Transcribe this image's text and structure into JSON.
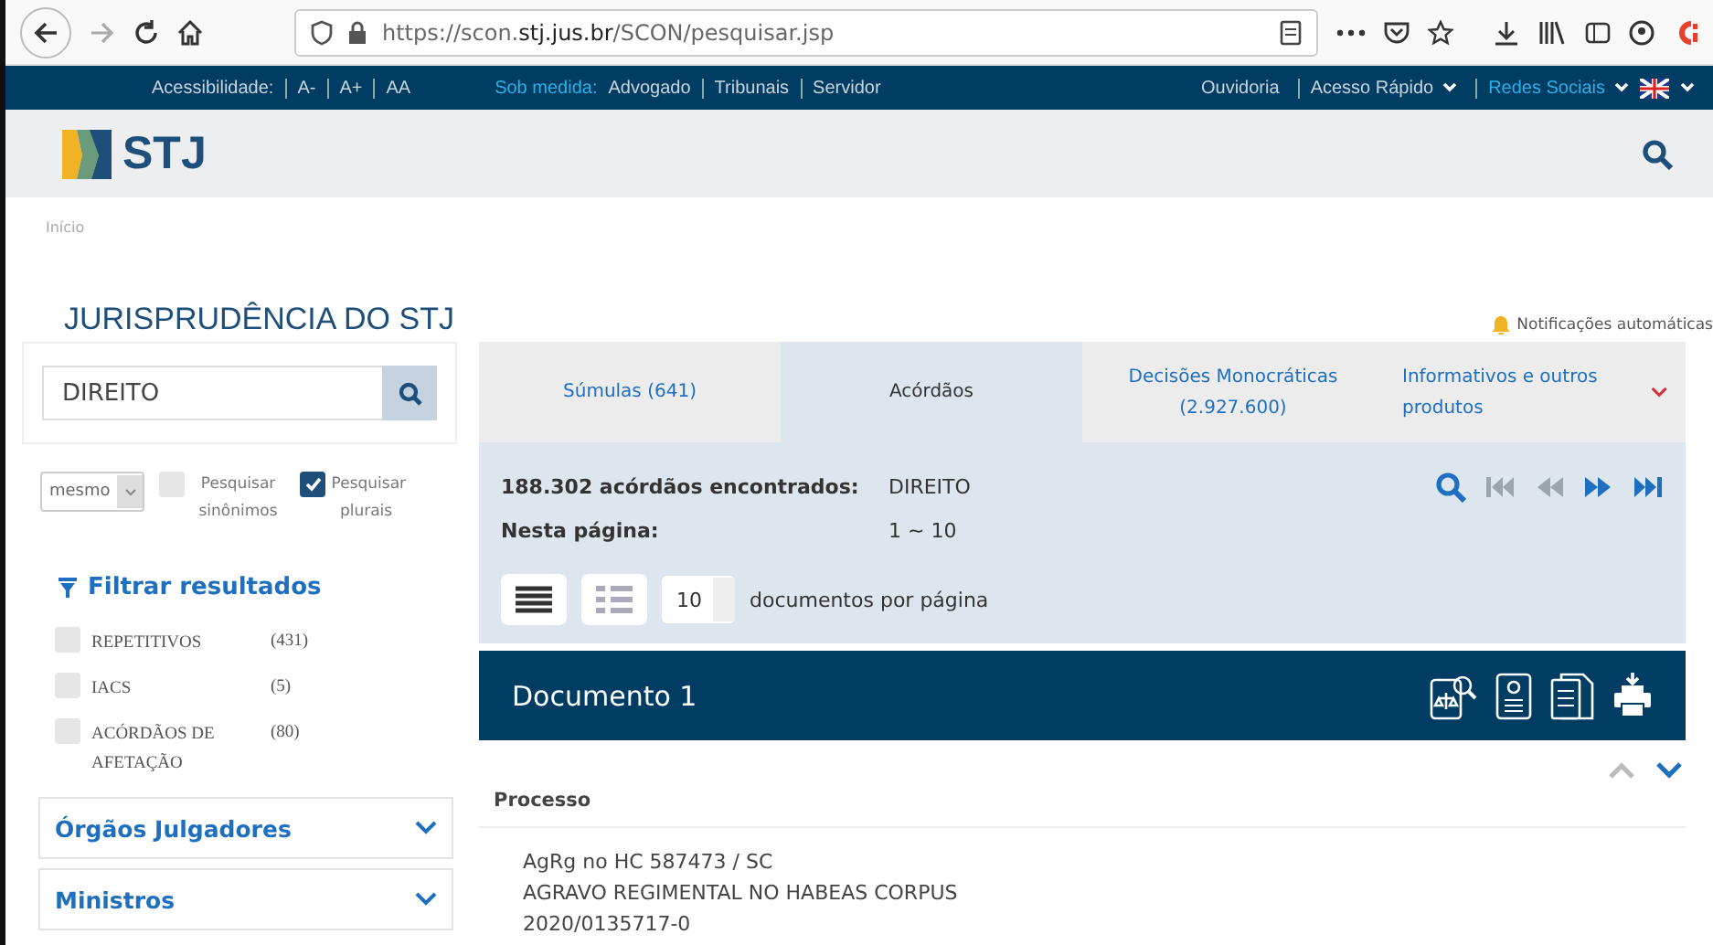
{
  "browser": {
    "url_prefix": "https://scon.",
    "url_domain": "stj.jus.br",
    "url_path": "/SCON/pesquisar.jsp"
  },
  "topbar": {
    "accessibility_label": "Acessibilidade:",
    "accessibility_links": [
      "A-",
      "A+",
      "AA"
    ],
    "sob_medida_label": "Sob medida:",
    "sob_medida_links": [
      "Advogado",
      "Tribunais",
      "Servidor"
    ],
    "right_links": [
      {
        "label": "Ouvidoria",
        "dropdown": false,
        "highlight": false
      },
      {
        "label": "Acesso Rápido",
        "dropdown": true,
        "highlight": false
      },
      {
        "label": "Redes Sociais",
        "dropdown": true,
        "highlight": true
      }
    ]
  },
  "logo": {
    "text": "STJ"
  },
  "breadcrumb": "Início",
  "page_title": "JURISPRUDÊNCIA DO STJ",
  "notifications": "Notificações automáticas",
  "search": {
    "value": "DIREITO"
  },
  "options": {
    "select_value": "mesmo",
    "checkboxes": [
      {
        "label": "Pesquisar sinônimos",
        "checked": false
      },
      {
        "label": "Pesquisar plurais",
        "checked": true
      }
    ]
  },
  "filter": {
    "title": "Filtrar resultados",
    "items": [
      {
        "label": "REPETITIVOS",
        "count": "(431)",
        "checked": false
      },
      {
        "label": "IACS",
        "count": "(5)",
        "checked": false
      },
      {
        "label": "ACÓRDÃOS DE AFETAÇÃO",
        "count": "(80)",
        "checked": false
      }
    ]
  },
  "sections": [
    {
      "label": "Órgãos Julgadores",
      "expanded": false
    },
    {
      "label": "Ministros",
      "expanded": false
    }
  ],
  "tabs": [
    {
      "label": "Súmulas (641)",
      "selected": false,
      "dropdown": false
    },
    {
      "label": "Acórdãos",
      "selected": true,
      "dropdown": false
    },
    {
      "label": "Decisões Monocráticas (2.927.600)",
      "selected": false,
      "dropdown": false
    },
    {
      "label": "Informativos e outros produtos",
      "selected": false,
      "dropdown": true
    }
  ],
  "summary": {
    "found_label": "188.302 acórdãos encontrados:",
    "found_value": "DIREITO",
    "page_label": "Nesta página:",
    "page_value": "1 ~ 10"
  },
  "pager": [
    {
      "kind": "search",
      "disabled": false
    },
    {
      "kind": "first",
      "disabled": true
    },
    {
      "kind": "prev",
      "disabled": true
    },
    {
      "kind": "next",
      "disabled": false
    },
    {
      "kind": "last",
      "disabled": false
    }
  ],
  "views": [
    {
      "kind": "list",
      "selected": true
    },
    {
      "kind": "detail",
      "selected": false
    }
  ],
  "per_page": {
    "value": "10",
    "label": "documentos por página"
  },
  "document": {
    "title": "Documento 1",
    "nav": [
      {
        "kind": "up",
        "disabled": true
      },
      {
        "kind": "down",
        "disabled": false
      }
    ],
    "field_label": "Processo",
    "lines": [
      "AgRg no HC 587473 / SC",
      "AGRAVO REGIMENTAL NO HABEAS CORPUS",
      "2020/0135717-0"
    ]
  }
}
